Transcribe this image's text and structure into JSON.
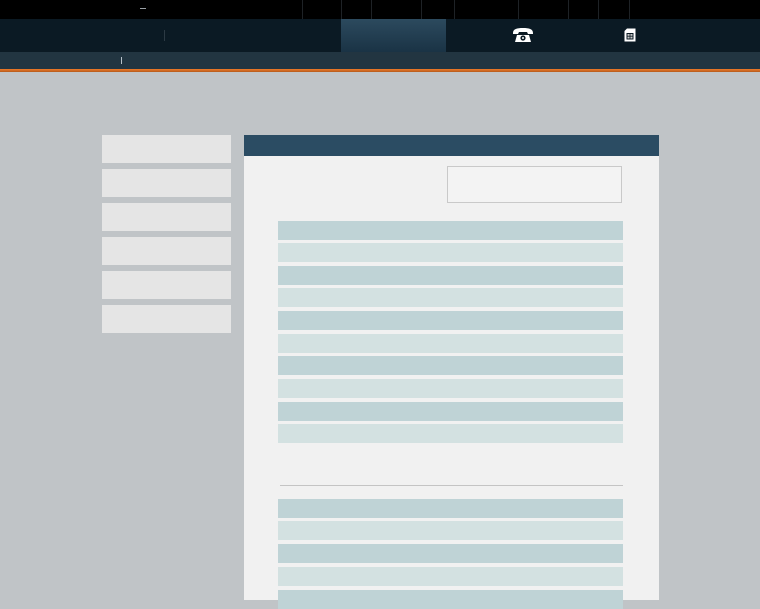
{
  "topbar": {
    "separators": 9
  },
  "nav": {
    "icons": [
      "telephone-icon",
      "sim-card-icon"
    ]
  },
  "sidebar": {
    "items": [
      "",
      "",
      "",
      "",
      "",
      ""
    ]
  },
  "panel": {
    "title": "",
    "search": {
      "value": "",
      "placeholder": ""
    },
    "table_a": {
      "rows": [
        "",
        "",
        "",
        "",
        "",
        "",
        "",
        "",
        "",
        ""
      ]
    },
    "table_b": {
      "rows": [
        "",
        "",
        "",
        "",
        ""
      ]
    }
  },
  "colors": {
    "accent": "#f07a28",
    "header": "#2b4c63",
    "nav": "#0b1a24",
    "row_dark": "#bfd3d6",
    "row_light": "#d3e1e1"
  }
}
